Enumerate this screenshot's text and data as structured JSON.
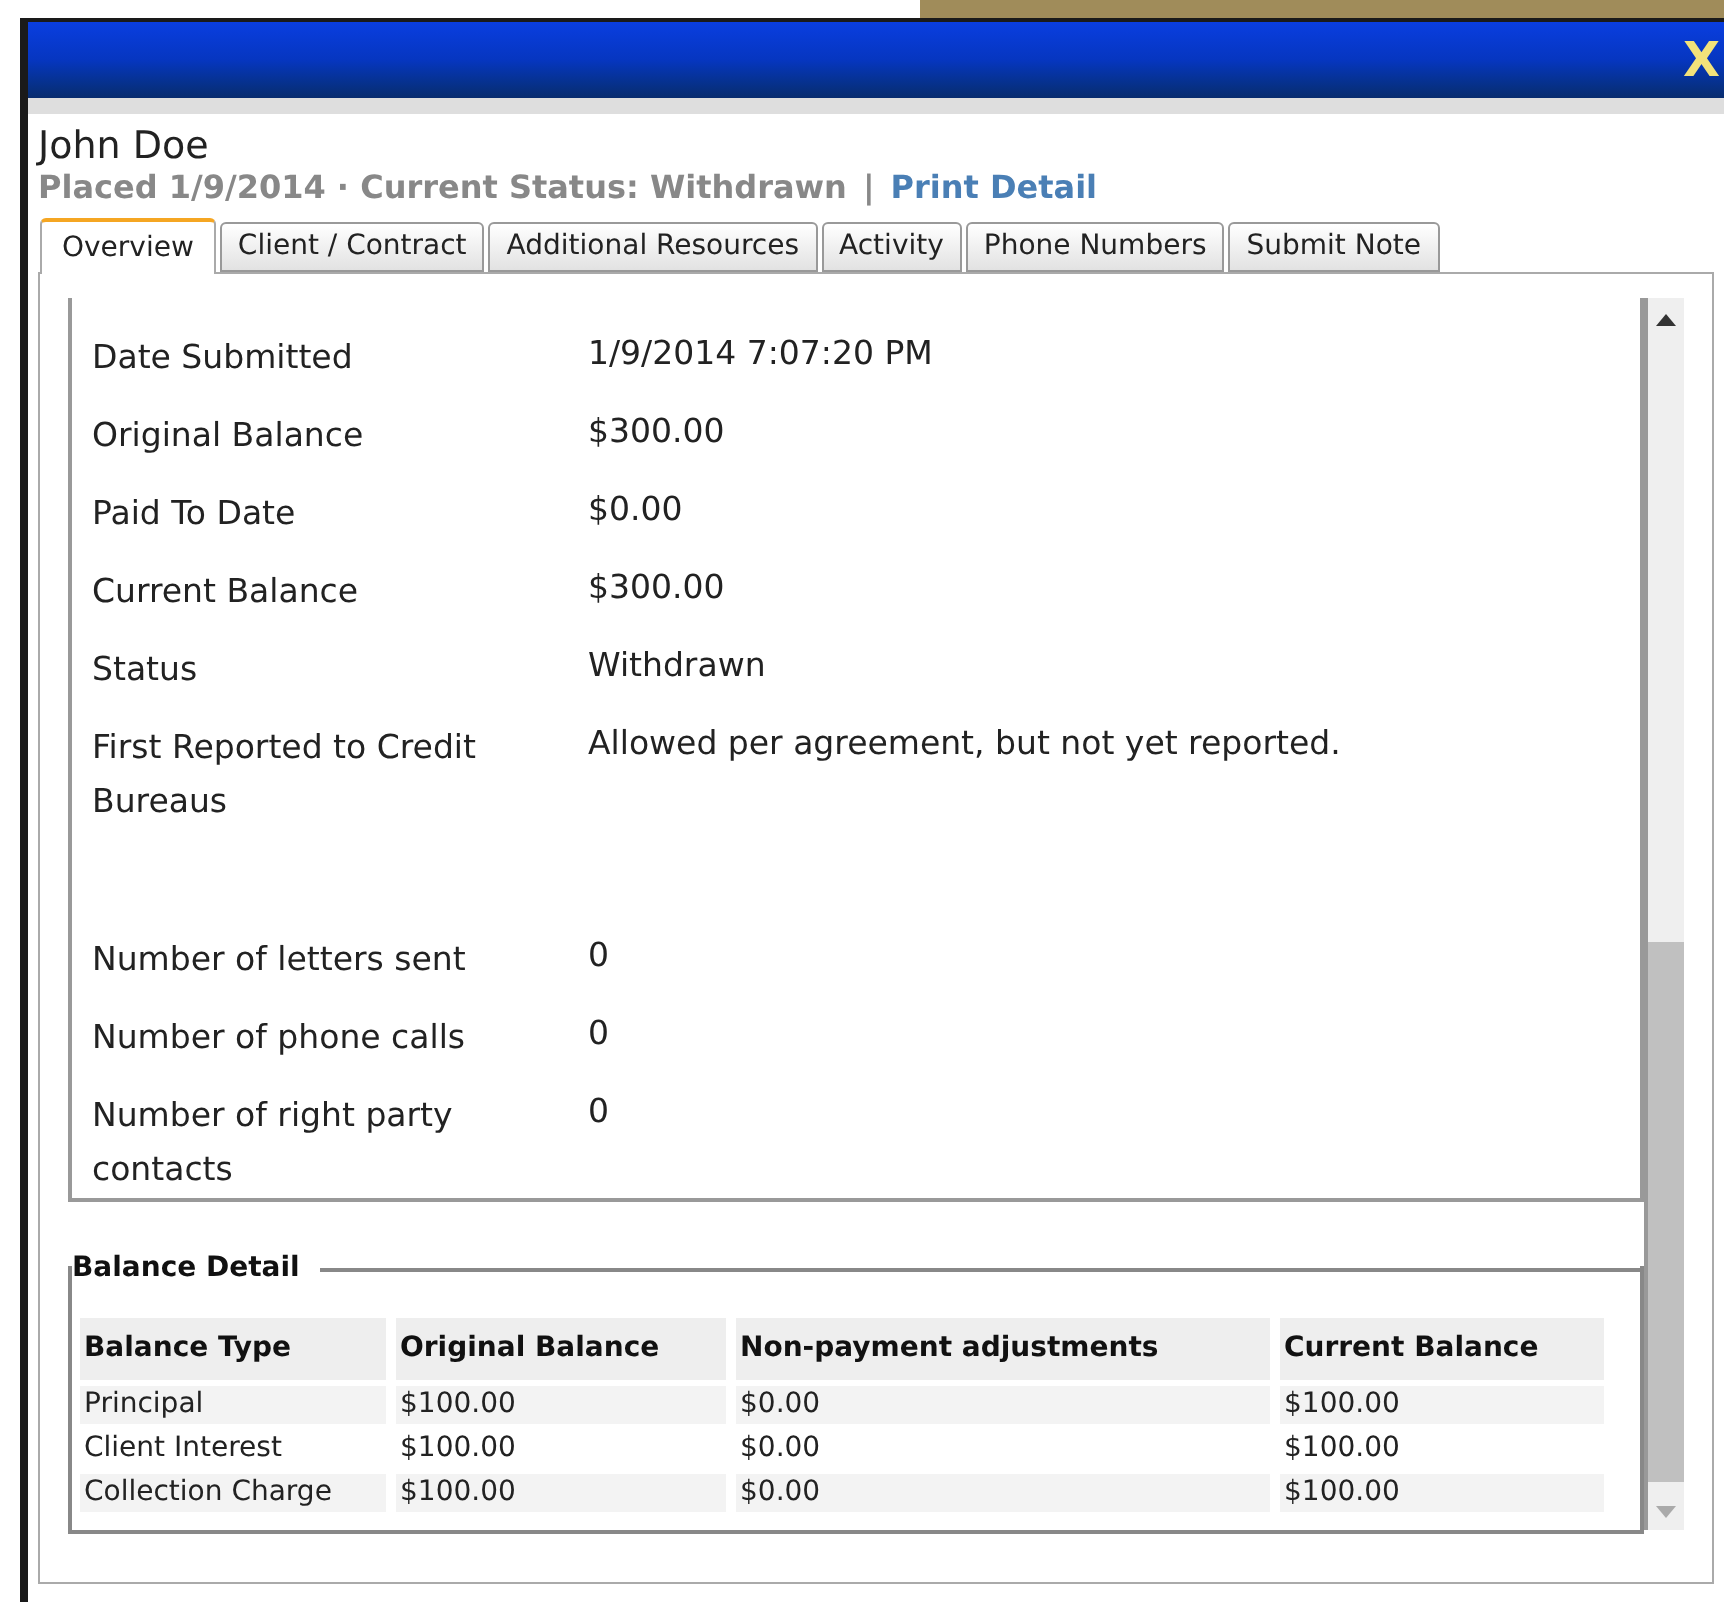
{
  "window": {
    "close_label": "X"
  },
  "header": {
    "name": "John Doe",
    "subtitle": "Placed 1/9/2014 · Current Status: Withdrawn",
    "separator": "|",
    "print_link": "Print Detail"
  },
  "tabs": [
    {
      "label": "Overview",
      "selected": true
    },
    {
      "label": "Client / Contract",
      "selected": false
    },
    {
      "label": "Additional Resources",
      "selected": false
    },
    {
      "label": "Activity",
      "selected": false
    },
    {
      "label": "Phone Numbers",
      "selected": false
    },
    {
      "label": "Submit Note",
      "selected": false
    }
  ],
  "details": [
    {
      "label": "Date Submitted",
      "value": "1/9/2014 7:07:20 PM",
      "tall": false
    },
    {
      "label": "Original Balance",
      "value": "$300.00",
      "tall": false
    },
    {
      "label": "Paid To Date",
      "value": "$0.00",
      "tall": false
    },
    {
      "label": "Current Balance",
      "value": "$300.00",
      "tall": false
    },
    {
      "label": "Status",
      "value": "Withdrawn",
      "tall": false
    },
    {
      "label": "First Reported to Credit Bureaus",
      "value": "Allowed per agreement, but not yet reported.",
      "tall": true
    },
    {
      "label": "Number of letters sent",
      "value": "0",
      "tall": false
    },
    {
      "label": "Number of phone calls",
      "value": "0",
      "tall": false
    },
    {
      "label": "Number of right party contacts",
      "value": "0",
      "tall": false
    }
  ],
  "balance_detail": {
    "legend": "Balance Detail",
    "columns": [
      "Balance Type",
      "Original Balance",
      "Non-payment adjustments",
      "Current Balance"
    ],
    "rows": [
      [
        "Principal",
        "$100.00",
        "$0.00",
        "$100.00"
      ],
      [
        "Client Interest",
        "$100.00",
        "$0.00",
        "$100.00"
      ],
      [
        "Collection Charge",
        "$100.00",
        "$0.00",
        "$100.00"
      ]
    ]
  }
}
